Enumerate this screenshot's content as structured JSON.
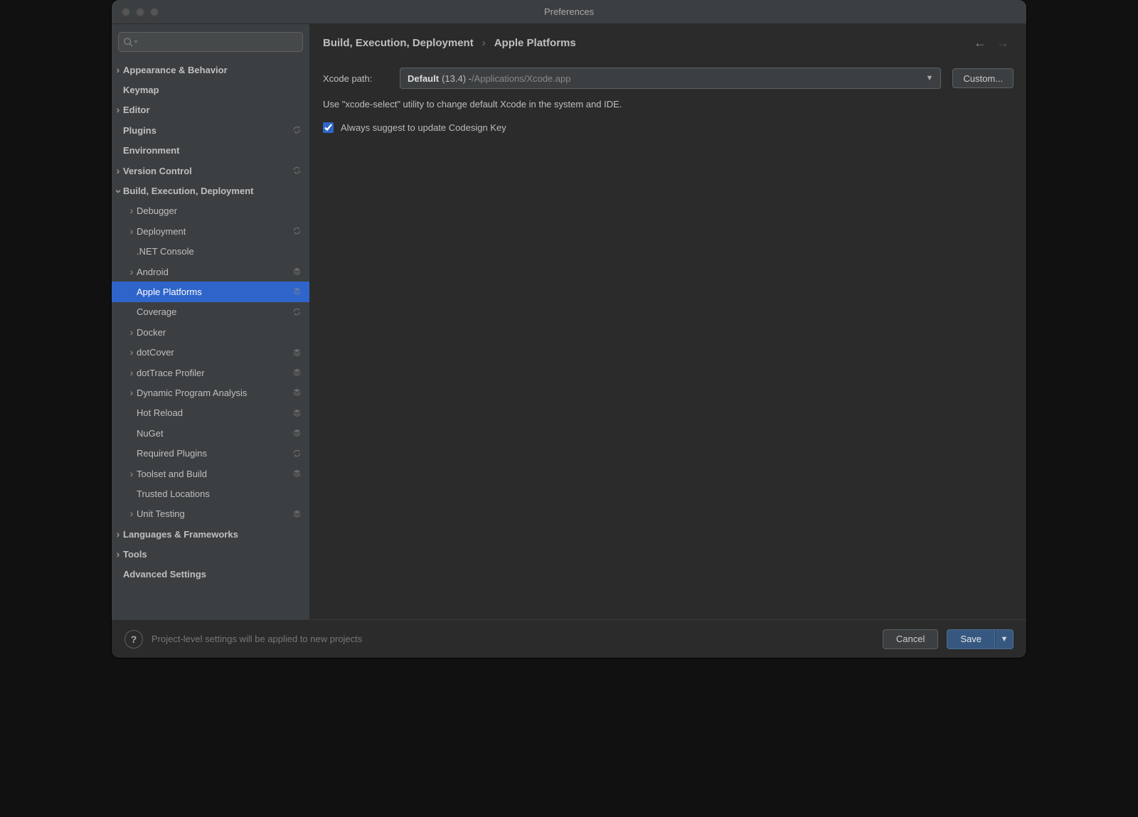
{
  "window": {
    "title": "Preferences"
  },
  "search": {
    "placeholder": ""
  },
  "sidebar": {
    "items": [
      {
        "label": "Appearance & Behavior",
        "depth": 0,
        "expandable": true,
        "expanded": false,
        "badge": null,
        "selected": false
      },
      {
        "label": "Keymap",
        "depth": 0,
        "expandable": false,
        "expanded": false,
        "badge": null,
        "selected": false
      },
      {
        "label": "Editor",
        "depth": 0,
        "expandable": true,
        "expanded": false,
        "badge": null,
        "selected": false
      },
      {
        "label": "Plugins",
        "depth": 0,
        "expandable": false,
        "expanded": false,
        "badge": "sync",
        "selected": false
      },
      {
        "label": "Environment",
        "depth": 0,
        "expandable": false,
        "expanded": false,
        "badge": null,
        "selected": false
      },
      {
        "label": "Version Control",
        "depth": 0,
        "expandable": true,
        "expanded": false,
        "badge": "sync",
        "selected": false
      },
      {
        "label": "Build, Execution, Deployment",
        "depth": 0,
        "expandable": true,
        "expanded": true,
        "badge": null,
        "selected": false
      },
      {
        "label": "Debugger",
        "depth": 1,
        "expandable": true,
        "expanded": false,
        "badge": null,
        "selected": false
      },
      {
        "label": "Deployment",
        "depth": 1,
        "expandable": true,
        "expanded": false,
        "badge": "sync",
        "selected": false
      },
      {
        "label": ".NET Console",
        "depth": 1,
        "expandable": false,
        "expanded": false,
        "badge": null,
        "selected": false
      },
      {
        "label": "Android",
        "depth": 1,
        "expandable": true,
        "expanded": false,
        "badge": "layer",
        "selected": false
      },
      {
        "label": "Apple Platforms",
        "depth": 1,
        "expandable": false,
        "expanded": false,
        "badge": "layer",
        "selected": true
      },
      {
        "label": "Coverage",
        "depth": 1,
        "expandable": false,
        "expanded": false,
        "badge": "sync",
        "selected": false
      },
      {
        "label": "Docker",
        "depth": 1,
        "expandable": true,
        "expanded": false,
        "badge": null,
        "selected": false
      },
      {
        "label": "dotCover",
        "depth": 1,
        "expandable": true,
        "expanded": false,
        "badge": "layer",
        "selected": false
      },
      {
        "label": "dotTrace Profiler",
        "depth": 1,
        "expandable": true,
        "expanded": false,
        "badge": "layer",
        "selected": false
      },
      {
        "label": "Dynamic Program Analysis",
        "depth": 1,
        "expandable": true,
        "expanded": false,
        "badge": "layer",
        "selected": false
      },
      {
        "label": "Hot Reload",
        "depth": 1,
        "expandable": false,
        "expanded": false,
        "badge": "layer",
        "selected": false
      },
      {
        "label": "NuGet",
        "depth": 1,
        "expandable": false,
        "expanded": false,
        "badge": "layer",
        "selected": false
      },
      {
        "label": "Required Plugins",
        "depth": 1,
        "expandable": false,
        "expanded": false,
        "badge": "sync",
        "selected": false
      },
      {
        "label": "Toolset and Build",
        "depth": 1,
        "expandable": true,
        "expanded": false,
        "badge": "layer",
        "selected": false
      },
      {
        "label": "Trusted Locations",
        "depth": 1,
        "expandable": false,
        "expanded": false,
        "badge": null,
        "selected": false
      },
      {
        "label": "Unit Testing",
        "depth": 1,
        "expandable": true,
        "expanded": false,
        "badge": "layer",
        "selected": false
      },
      {
        "label": "Languages & Frameworks",
        "depth": 0,
        "expandable": true,
        "expanded": false,
        "badge": null,
        "selected": false
      },
      {
        "label": "Tools",
        "depth": 0,
        "expandable": true,
        "expanded": false,
        "badge": null,
        "selected": false
      },
      {
        "label": "Advanced Settings",
        "depth": 0,
        "expandable": false,
        "expanded": false,
        "badge": null,
        "selected": false
      }
    ]
  },
  "breadcrumb": {
    "part1": "Build, Execution, Deployment",
    "part2": "Apple Platforms"
  },
  "form": {
    "xcode_label": "Xcode path:",
    "xcode_value_bold": "Default",
    "xcode_value_mid": "(13.4) - ",
    "xcode_value_dim": "/Applications/Xcode.app",
    "custom_button": "Custom...",
    "hint": "Use \"xcode-select\" utility to change default Xcode in the system and IDE.",
    "codesign_check_label": "Always suggest to update Codesign Key",
    "codesign_checked": true
  },
  "footer": {
    "help": "?",
    "project_hint": "Project-level settings will be applied to new projects",
    "cancel": "Cancel",
    "save": "Save"
  }
}
